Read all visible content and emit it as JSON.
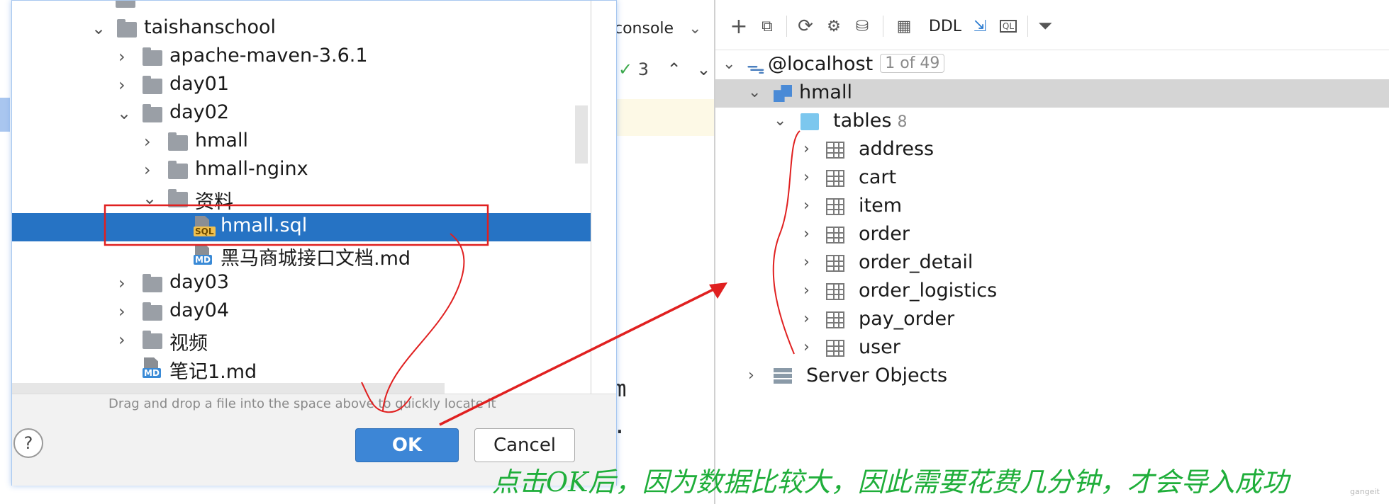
{
  "editor": {
    "console_label": "console",
    "check_count": "3"
  },
  "file_dialog": {
    "tree": [
      {
        "label": "taishanschool",
        "expanded": true
      },
      {
        "label": "apache-maven-3.6.1",
        "expanded": false
      },
      {
        "label": "day01",
        "expanded": false
      },
      {
        "label": "day02",
        "expanded": true
      },
      {
        "label": "hmall",
        "expanded": false
      },
      {
        "label": "hmall-nginx",
        "expanded": false
      },
      {
        "label": "资料",
        "expanded": true
      },
      {
        "label": "hmall.sql",
        "type": "sql",
        "selected": true
      },
      {
        "label": "黑马商城接口文档.md",
        "type": "md"
      },
      {
        "label": "day03",
        "expanded": false
      },
      {
        "label": "day04",
        "expanded": false
      },
      {
        "label": "视频",
        "expanded": false
      },
      {
        "label": "笔记1.md",
        "type": "md"
      }
    ],
    "drag_hint": "Drag and drop a file into the space above to quickly locate it",
    "help_label": "?",
    "ok_label": "OK",
    "cancel_label": "Cancel"
  },
  "db_panel": {
    "toolbar": {
      "add": "+",
      "ddl": "DDL",
      "ql": "QL"
    },
    "connection": {
      "label": "@localhost",
      "badge": "1 of 49"
    },
    "schema": "hmall",
    "tables_label": "tables",
    "tables_count": "8",
    "tables": [
      "address",
      "cart",
      "item",
      "order",
      "order_detail",
      "order_logistics",
      "pay_order",
      "user"
    ],
    "server_objects": "Server Objects"
  },
  "annotation": "点击OK后，因为数据比较大，因此需要花费几分钟，才会导入成功",
  "watermark": "gangeit",
  "colors": {
    "selection": "#2673c4",
    "ok_button": "#3d86d6",
    "annotation_green": "#1fae3a",
    "annotation_red": "#e02020"
  }
}
